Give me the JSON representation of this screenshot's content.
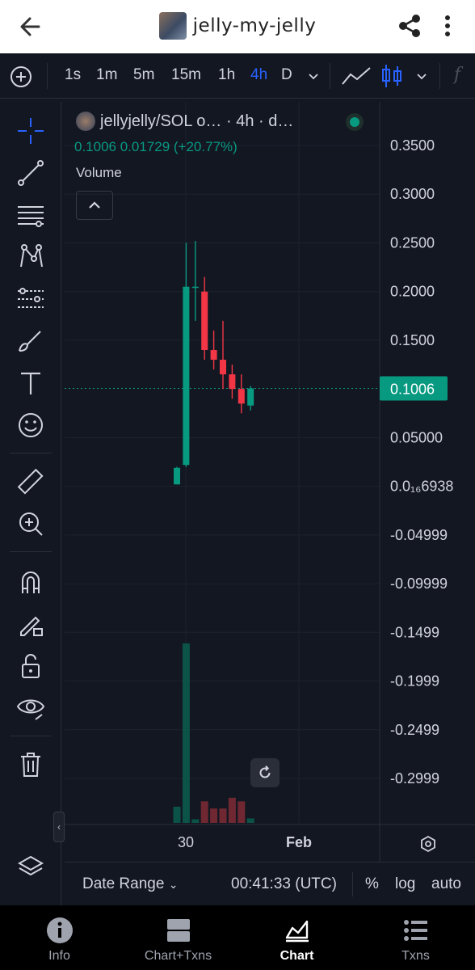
{
  "app_bar": {
    "title": "jelly-my-jelly"
  },
  "toolbar": {
    "timeframes": [
      "1s",
      "1m",
      "5m",
      "15m",
      "1h",
      "4h",
      "D"
    ],
    "active_timeframe": "4h"
  },
  "legend": {
    "symbol": "jellyjelly/SOL o… · 4h · d…",
    "ohlc": "0.1006  0.01729 (+20.77%)",
    "volume_label": "Volume"
  },
  "price_axis": {
    "labels": [
      "0.3500",
      "0.3000",
      "0.2500",
      "0.2000",
      "0.1500",
      "0.1006",
      "0.05000",
      "0.0₁₆6938",
      "-0.04999",
      "-0.09999",
      "-0.1499",
      "-0.1999",
      "-0.2499",
      "-0.2999"
    ],
    "current_price_label": "0.1006"
  },
  "time_axis": {
    "labels": [
      "30",
      "Feb"
    ]
  },
  "range_bar": {
    "date_range": "Date Range",
    "time": "00:41:33 (UTC)",
    "percent": "%",
    "log": "log",
    "auto": "auto"
  },
  "bottom_nav": {
    "items": [
      {
        "label": "Info",
        "icon": "info-icon"
      },
      {
        "label": "Chart+Txns",
        "icon": "chart-txns-icon"
      },
      {
        "label": "Chart",
        "icon": "chart-icon"
      },
      {
        "label": "Txns",
        "icon": "list-icon"
      }
    ],
    "active": "Chart"
  },
  "colors": {
    "up": "#089981",
    "down": "#f23645",
    "accent": "#2962ff",
    "background": "#131722"
  },
  "chart_data": {
    "type": "candlestick",
    "ylim": [
      -0.33,
      0.37
    ],
    "price_ticks": [
      0.35,
      0.3,
      0.25,
      0.2,
      0.15,
      0.05,
      0.0,
      -0.04999,
      -0.09999,
      -0.1499,
      -0.1999,
      -0.2499,
      -0.2999
    ],
    "current_price": 0.1006,
    "candles": [
      {
        "o": 0.002,
        "h": 0.02,
        "l": 0.002,
        "c": 0.019,
        "v": 0.09
      },
      {
        "o": 0.022,
        "h": 0.25,
        "l": 0.02,
        "c": 0.205,
        "v": 1.0
      },
      {
        "o": 0.205,
        "h": 0.252,
        "l": 0.17,
        "c": 0.205,
        "v": 0.02
      },
      {
        "o": 0.2,
        "h": 0.215,
        "l": 0.13,
        "c": 0.14,
        "v": 0.12
      },
      {
        "o": 0.14,
        "h": 0.16,
        "l": 0.12,
        "c": 0.13,
        "v": 0.08
      },
      {
        "o": 0.13,
        "h": 0.17,
        "l": 0.1,
        "c": 0.115,
        "v": 0.08
      },
      {
        "o": 0.115,
        "h": 0.125,
        "l": 0.09,
        "c": 0.1,
        "v": 0.14
      },
      {
        "o": 0.1,
        "h": 0.115,
        "l": 0.075,
        "c": 0.085,
        "v": 0.12
      },
      {
        "o": 0.083,
        "h": 0.103,
        "l": 0.078,
        "c": 0.1006,
        "v": 0.025
      }
    ]
  }
}
